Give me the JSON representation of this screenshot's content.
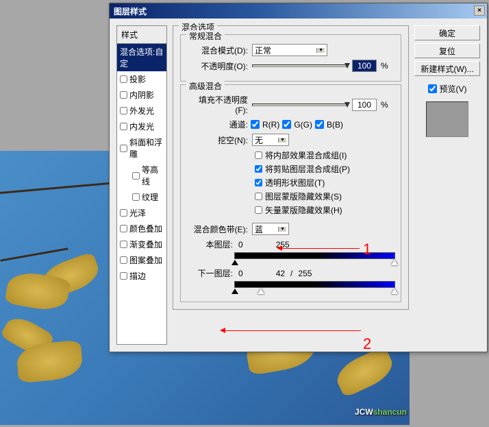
{
  "dialog": {
    "title": "图层样式",
    "close_x": "×"
  },
  "styles": {
    "header": "样式",
    "blending_options": "混合选项:自定",
    "drop_shadow": "投影",
    "inner_shadow": "内阴影",
    "outer_glow": "外发光",
    "inner_glow": "内发光",
    "bevel_emboss": "斜面和浮雕",
    "contour": "等高线",
    "texture": "纹理",
    "satin": "光泽",
    "color_overlay": "颜色叠加",
    "gradient_overlay": "渐变叠加",
    "pattern_overlay": "图案叠加",
    "stroke": "描边"
  },
  "options": {
    "section": "混合选项",
    "general": {
      "label": "常规混合",
      "blend_mode_label": "混合模式(D):",
      "blend_mode_value": "正常",
      "opacity_label": "不透明度(O):",
      "opacity_value": "100",
      "percent": "%"
    },
    "advanced": {
      "label": "高级混合",
      "fill_opacity_label": "填充不透明度(F):",
      "fill_opacity_value": "100",
      "percent": "%",
      "channels_label": "通道:",
      "ch_r": "R(R)",
      "ch_g": "G(G)",
      "ch_b": "B(B)",
      "knockout_label": "挖空(N):",
      "knockout_value": "无",
      "blend_interior": "将内部效果混合成组(I)",
      "blend_clipped": "将剪贴图层混合成组(P)",
      "transparency_shapes": "透明形状图层(T)",
      "layer_mask_hides": "图层蒙版隐藏效果(S)",
      "vector_mask_hides": "矢量蒙版隐藏效果(H)"
    },
    "blend_if": {
      "label": "混合颜色带(E):",
      "channel": "蓝",
      "this_layer_label": "本图层:",
      "this_layer_low": "0",
      "this_layer_high": "255",
      "underlying_label": "下一图层:",
      "underlying_low": "0",
      "underlying_mid": "42",
      "underlying_sep": "/",
      "underlying_high": "255"
    }
  },
  "buttons": {
    "ok": "确定",
    "cancel": "复位",
    "new_style": "新建样式(W)...",
    "preview_label": "预览(V)"
  },
  "annotations": {
    "one": "1",
    "two": "2"
  },
  "signature": {
    "jcw": "JCW",
    "shancun": "shancun"
  }
}
